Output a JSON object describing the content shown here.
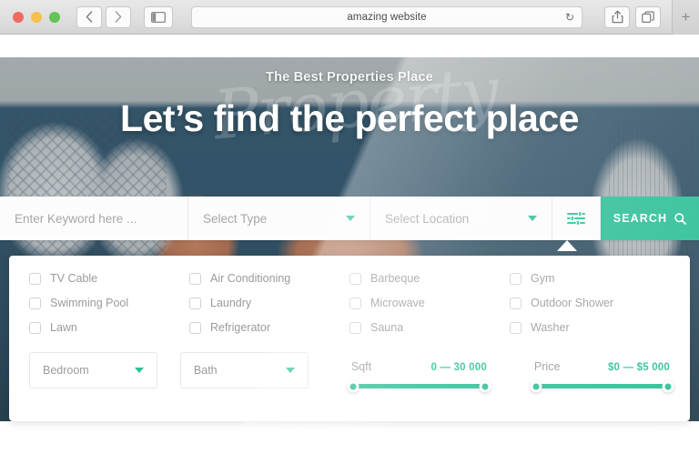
{
  "browser": {
    "title": "amazing website",
    "traffic_lights": [
      "close",
      "minimize",
      "maximize"
    ],
    "back_label": "‹",
    "forward_label": "›",
    "sidebar_icon": "sidebar-icon",
    "reload_label": "↻",
    "share_icon": "share-icon",
    "tabs_icon": "tabs-overview-icon",
    "new_tab_label": "+"
  },
  "hero": {
    "kicker": "The Best Properties Place",
    "title": "Let’s find the perfect place",
    "watermark": "Property"
  },
  "search": {
    "keyword_placeholder": "Enter Keyword here ...",
    "type_label": "Select Type",
    "location_label": "Select Location",
    "filter_icon": "sliders-icon",
    "button_label": "SEARCH",
    "button_icon": "search-icon",
    "accent_color": "#2ebf97"
  },
  "filters": {
    "amenities": [
      "TV Cable",
      "Air Conditioning",
      "Barbeque",
      "Gym",
      "Swimming Pool",
      "Laundry",
      "Microwave",
      "Outdoor Shower",
      "Lawn",
      "Refrigerator",
      "Sauna",
      "Washer"
    ],
    "bedroom_label": "Bedroom",
    "bath_label": "Bath",
    "sliders": [
      {
        "name": "Sqft",
        "range": "0 — 30 000"
      },
      {
        "name": "Price",
        "range": "$0 — $5 000"
      }
    ]
  }
}
